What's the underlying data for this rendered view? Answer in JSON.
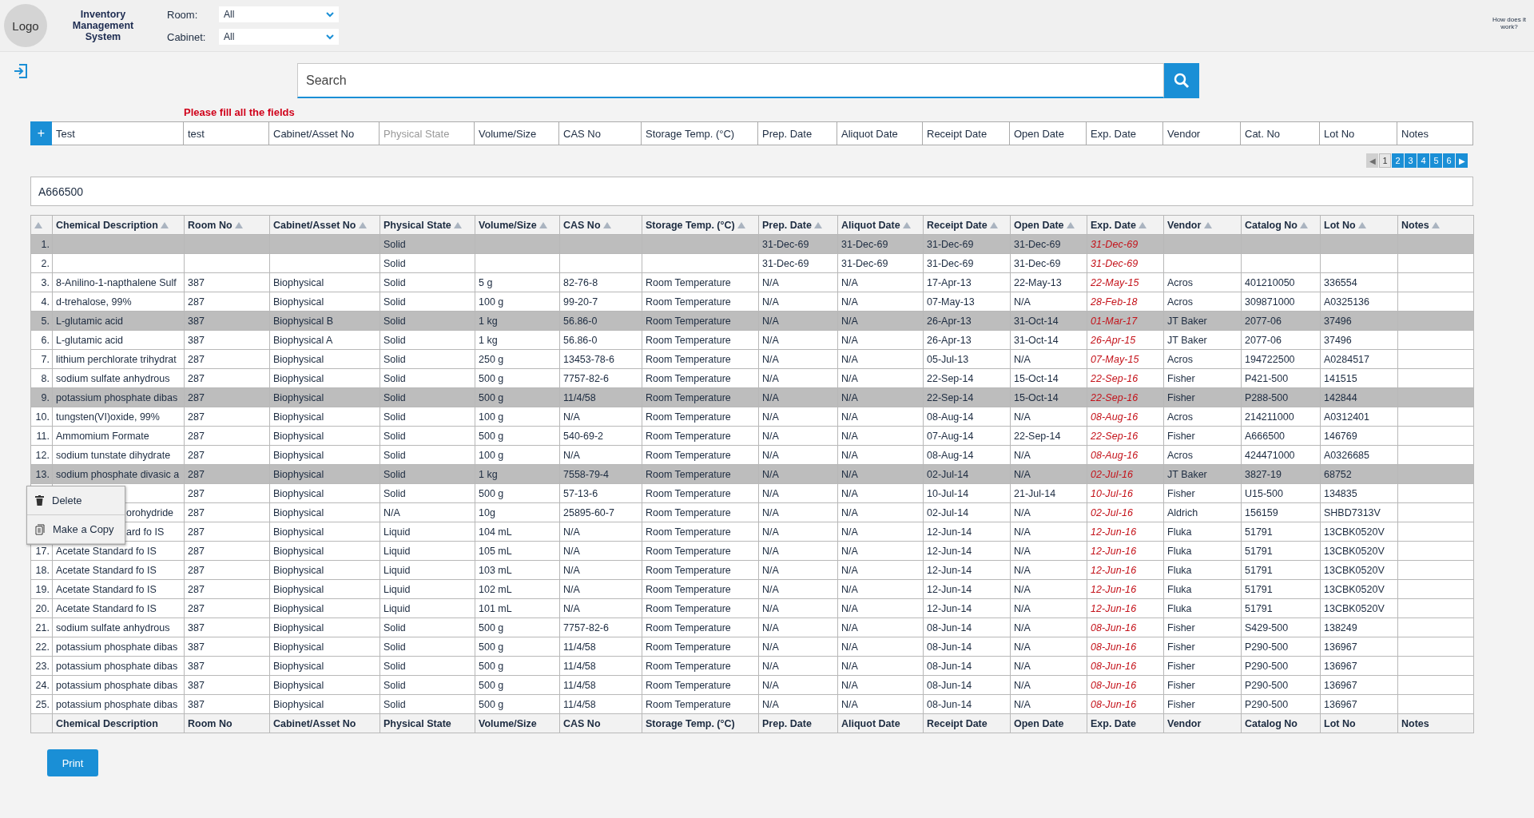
{
  "header": {
    "logo": "Logo",
    "app_title": "Inventory Management System",
    "filters": [
      {
        "label": "Room:",
        "value": "All"
      },
      {
        "label": "Cabinet:",
        "value": "All"
      }
    ],
    "help_link": "How does it work?"
  },
  "search": {
    "placeholder": "Search"
  },
  "form": {
    "error": "Please fill all the fields",
    "add_button": "+",
    "fields": [
      {
        "kind": "text",
        "value": "Test"
      },
      {
        "kind": "text",
        "value": "test"
      },
      {
        "kind": "text",
        "placeholder": "Cabinet/Asset No"
      },
      {
        "kind": "select",
        "placeholder": "Physical State"
      },
      {
        "kind": "text",
        "placeholder": "Volume/Size"
      },
      {
        "kind": "text",
        "placeholder": "CAS No"
      },
      {
        "kind": "text",
        "placeholder": "Storage Temp. (°C)"
      },
      {
        "kind": "text",
        "placeholder": "Prep. Date"
      },
      {
        "kind": "text",
        "placeholder": "Aliquot Date"
      },
      {
        "kind": "text",
        "placeholder": "Receipt Date"
      },
      {
        "kind": "text",
        "placeholder": "Open Date"
      },
      {
        "kind": "text",
        "placeholder": "Exp. Date"
      },
      {
        "kind": "text",
        "placeholder": "Vendor"
      },
      {
        "kind": "text",
        "placeholder": "Cat. No"
      },
      {
        "kind": "text",
        "placeholder": "Lot No"
      },
      {
        "kind": "text",
        "placeholder": "Notes"
      }
    ]
  },
  "pagination": [
    {
      "kind": "prev",
      "label": "◀",
      "disabled": true,
      "selected": false
    },
    {
      "kind": "page",
      "label": "1",
      "disabled": false,
      "selected": true
    },
    {
      "kind": "page",
      "label": "2",
      "disabled": false,
      "selected": false
    },
    {
      "kind": "page",
      "label": "3",
      "disabled": false,
      "selected": false
    },
    {
      "kind": "page",
      "label": "4",
      "disabled": false,
      "selected": false
    },
    {
      "kind": "page",
      "label": "5",
      "disabled": false,
      "selected": false
    },
    {
      "kind": "page",
      "label": "6",
      "disabled": false,
      "selected": false
    },
    {
      "kind": "next",
      "label": "▶",
      "disabled": false,
      "selected": false
    }
  ],
  "filter_box": {
    "value": "A666500"
  },
  "table": {
    "columns": [
      {
        "label": "Chemical Description",
        "kind": "text"
      },
      {
        "label": "Room No",
        "kind": "text"
      },
      {
        "label": "Cabinet/Asset No",
        "kind": "text"
      },
      {
        "label": "Physical State",
        "kind": "text"
      },
      {
        "label": "Volume/Size",
        "kind": "text"
      },
      {
        "label": "CAS No",
        "kind": "text"
      },
      {
        "label": "Storage Temp. (°C)",
        "kind": "text"
      },
      {
        "label": "Prep. Date",
        "kind": "text"
      },
      {
        "label": "Aliquot Date",
        "kind": "text"
      },
      {
        "label": "Receipt Date",
        "kind": "text"
      },
      {
        "label": "Open Date",
        "kind": "text"
      },
      {
        "label": "Exp. Date",
        "kind": "expiry"
      },
      {
        "label": "Vendor",
        "kind": "text"
      },
      {
        "label": "Catalog No",
        "kind": "text"
      },
      {
        "label": "Lot No",
        "kind": "text"
      },
      {
        "label": "Notes",
        "kind": "text"
      }
    ],
    "rows": [
      {
        "num": "1.",
        "selected": true,
        "cells": [
          null,
          null,
          null,
          "Solid",
          null,
          null,
          null,
          "31-Dec-69",
          "31-Dec-69",
          "31-Dec-69",
          "31-Dec-69",
          "31-Dec-69",
          null,
          null,
          null,
          null
        ]
      },
      {
        "num": "2.",
        "selected": false,
        "cells": [
          null,
          null,
          null,
          "Solid",
          null,
          null,
          null,
          "31-Dec-69",
          "31-Dec-69",
          "31-Dec-69",
          "31-Dec-69",
          "31-Dec-69",
          null,
          null,
          null,
          null
        ]
      },
      {
        "num": "3.",
        "selected": false,
        "cells": [
          "8-Anilino-1-napthalene Sulf",
          "387",
          "Biophysical",
          "Solid",
          "5 g",
          "82-76-8",
          "Room Temperature",
          "N/A",
          "N/A",
          "17-Apr-13",
          "22-May-13",
          "22-May-15",
          "Acros",
          "401210050",
          "336554",
          null
        ]
      },
      {
        "num": "4.",
        "selected": false,
        "cells": [
          "d-trehalose, 99%",
          "287",
          "Biophysical",
          "Solid",
          "100 g",
          "99-20-7",
          "Room Temperature",
          "N/A",
          "N/A",
          "07-May-13",
          "N/A",
          "28-Feb-18",
          "Acros",
          "309871000",
          "A0325136",
          null
        ]
      },
      {
        "num": "5.",
        "selected": true,
        "cells": [
          "L-glutamic acid",
          "387",
          "Biophysical B",
          "Solid",
          "1 kg",
          "56.86-0",
          "Room Temperature",
          "N/A",
          "N/A",
          "26-Apr-13",
          "31-Oct-14",
          "01-Mar-17",
          "JT Baker",
          "2077-06",
          "37496",
          null
        ]
      },
      {
        "num": "6.",
        "selected": false,
        "cells": [
          "L-glutamic acid",
          "387",
          "Biophysical A",
          "Solid",
          "1 kg",
          "56.86-0",
          "Room Temperature",
          "N/A",
          "N/A",
          "26-Apr-13",
          "31-Oct-14",
          "26-Apr-15",
          "JT Baker",
          "2077-06",
          "37496",
          null
        ]
      },
      {
        "num": "7.",
        "selected": false,
        "cells": [
          "lithium perchlorate trihydrat",
          "287",
          "Biophysical",
          "Solid",
          "250 g",
          "13453-78-6",
          "Room Temperature",
          "N/A",
          "N/A",
          "05-Jul-13",
          "N/A",
          "07-May-15",
          "Acros",
          "194722500",
          "A0284517",
          null
        ]
      },
      {
        "num": "8.",
        "selected": false,
        "cells": [
          "sodium sulfate anhydrous",
          "287",
          "Biophysical",
          "Solid",
          "500 g",
          "7757-82-6",
          "Room Temperature",
          "N/A",
          "N/A",
          "22-Sep-14",
          "15-Oct-14",
          "22-Sep-16",
          "Fisher",
          "P421-500",
          "141515",
          null
        ]
      },
      {
        "num": "9.",
        "selected": true,
        "cells": [
          "potassium phosphate dibas",
          "287",
          "Biophysical",
          "Solid",
          "500 g",
          "11/4/58",
          "Room Temperature",
          "N/A",
          "N/A",
          "22-Sep-14",
          "15-Oct-14",
          "22-Sep-16",
          "Fisher",
          "P288-500",
          "142844",
          null
        ]
      },
      {
        "num": "10.",
        "selected": false,
        "cells": [
          "tungsten(VI)oxide, 99%",
          "287",
          "Biophysical",
          "Solid",
          "100 g",
          "N/A",
          "Room Temperature",
          "N/A",
          "N/A",
          "08-Aug-14",
          "N/A",
          "08-Aug-16",
          "Acros",
          "214211000",
          "A0312401",
          null
        ]
      },
      {
        "num": "11.",
        "selected": false,
        "cells": [
          "Ammomium Formate",
          "287",
          "Biophysical",
          "Solid",
          "500 g",
          "540-69-2",
          "Room Temperature",
          "N/A",
          "N/A",
          "07-Aug-14",
          "22-Sep-14",
          "22-Sep-16",
          "Fisher",
          "A666500",
          "146769",
          null
        ]
      },
      {
        "num": "12.",
        "selected": false,
        "cells": [
          "sodium tunstate dihydrate",
          "287",
          "Biophysical",
          "Solid",
          "100 g",
          "N/A",
          "Room Temperature",
          "N/A",
          "N/A",
          "08-Aug-14",
          "N/A",
          "08-Aug-16",
          "Acros",
          "424471000",
          "A0326685",
          null
        ]
      },
      {
        "num": "13.",
        "selected": true,
        "cells": [
          "sodium phosphate divasic a",
          "287",
          "Biophysical",
          "Solid",
          "1 kg",
          "7558-79-4",
          "Room Temperature",
          "N/A",
          "N/A",
          "02-Jul-14",
          "N/A",
          "02-Jul-16",
          "JT Baker",
          "3827-19",
          "68752",
          null
        ]
      },
      {
        "selected": false,
        "cells": [
          null,
          "287",
          "Biophysical",
          "Solid",
          "500 g",
          "57-13-6",
          "Room Temperature",
          "N/A",
          "N/A",
          "10-Jul-14",
          "21-Jul-14",
          "10-Jul-16",
          "Fisher",
          "U15-500",
          "134835",
          null
        ]
      },
      {
        "selected": false,
        "cells": [
          "orohydride",
          "287",
          "Biophysical",
          "N/A",
          "10g",
          "25895-60-7",
          "Room Temperature",
          "N/A",
          "N/A",
          "02-Jul-14",
          "N/A",
          "02-Jul-16",
          "Aldrich",
          "156159",
          "SHBD7313V",
          null
        ]
      },
      {
        "selected": false,
        "cells": [
          "ard fo IS",
          "287",
          "Biophysical",
          "Liquid",
          "104 mL",
          "N/A",
          "Room Temperature",
          "N/A",
          "N/A",
          "12-Jun-14",
          "N/A",
          "12-Jun-16",
          "Fluka",
          "51791",
          "13CBK0520V",
          null
        ]
      },
      {
        "num": "17.",
        "selected": false,
        "cells": [
          "Acetate Standard fo IS",
          "287",
          "Biophysical",
          "Liquid",
          "105 mL",
          "N/A",
          "Room Temperature",
          "N/A",
          "N/A",
          "12-Jun-14",
          "N/A",
          "12-Jun-16",
          "Fluka",
          "51791",
          "13CBK0520V",
          null
        ]
      },
      {
        "num": "18.",
        "selected": false,
        "cells": [
          "Acetate Standard fo IS",
          "287",
          "Biophysical",
          "Liquid",
          "103 mL",
          "N/A",
          "Room Temperature",
          "N/A",
          "N/A",
          "12-Jun-14",
          "N/A",
          "12-Jun-16",
          "Fluka",
          "51791",
          "13CBK0520V",
          null
        ]
      },
      {
        "num": "19.",
        "selected": false,
        "cells": [
          "Acetate Standard fo IS",
          "287",
          "Biophysical",
          "Liquid",
          "102 mL",
          "N/A",
          "Room Temperature",
          "N/A",
          "N/A",
          "12-Jun-14",
          "N/A",
          "12-Jun-16",
          "Fluka",
          "51791",
          "13CBK0520V",
          null
        ]
      },
      {
        "num": "20.",
        "selected": false,
        "cells": [
          "Acetate Standard fo IS",
          "287",
          "Biophysical",
          "Liquid",
          "101 mL",
          "N/A",
          "Room Temperature",
          "N/A",
          "N/A",
          "12-Jun-14",
          "N/A",
          "12-Jun-16",
          "Fluka",
          "51791",
          "13CBK0520V",
          null
        ]
      },
      {
        "num": "21.",
        "selected": false,
        "cells": [
          "sodium sulfate anhydrous",
          "387",
          "Biophysical",
          "Solid",
          "500 g",
          "7757-82-6",
          "Room Temperature",
          "N/A",
          "N/A",
          "08-Jun-14",
          "N/A",
          "08-Jun-16",
          "Fisher",
          "S429-500",
          "138249",
          null
        ]
      },
      {
        "num": "22.",
        "selected": false,
        "cells": [
          "potassium phosphate dibas",
          "387",
          "Biophysical",
          "Solid",
          "500 g",
          "11/4/58",
          "Room Temperature",
          "N/A",
          "N/A",
          "08-Jun-14",
          "N/A",
          "08-Jun-16",
          "Fisher",
          "P290-500",
          "136967",
          null
        ]
      },
      {
        "num": "23.",
        "selected": false,
        "cells": [
          "potassium phosphate dibas",
          "387",
          "Biophysical",
          "Solid",
          "500 g",
          "11/4/58",
          "Room Temperature",
          "N/A",
          "N/A",
          "08-Jun-14",
          "N/A",
          "08-Jun-16",
          "Fisher",
          "P290-500",
          "136967",
          null
        ]
      },
      {
        "num": "24.",
        "selected": false,
        "cells": [
          "potassium phosphate dibas",
          "387",
          "Biophysical",
          "Solid",
          "500 g",
          "11/4/58",
          "Room Temperature",
          "N/A",
          "N/A",
          "08-Jun-14",
          "N/A",
          "08-Jun-16",
          "Fisher",
          "P290-500",
          "136967",
          null
        ]
      },
      {
        "num": "25.",
        "selected": false,
        "cells": [
          "potassium phosphate dibas",
          "387",
          "Biophysical",
          "Solid",
          "500 g",
          "11/4/58",
          "Room Temperature",
          "N/A",
          "N/A",
          "08-Jun-14",
          "N/A",
          "08-Jun-16",
          "Fisher",
          "P290-500",
          "136967",
          null
        ]
      }
    ],
    "footer_labels": [
      "Chemical Description",
      "Room No",
      "Cabinet/Asset No",
      "Physical State",
      "Volume/Size",
      "CAS No",
      "Storage Temp. (°C)",
      "Prep. Date",
      "Aliquot Date",
      "Receipt Date",
      "Open Date",
      "Exp. Date",
      "Vendor",
      "Catalog No",
      "Lot No",
      "Notes"
    ]
  },
  "context_menu": [
    {
      "kind": "delete",
      "label": "Delete"
    },
    {
      "kind": "copy",
      "label": "Make a Copy"
    }
  ],
  "print_button": "Print"
}
